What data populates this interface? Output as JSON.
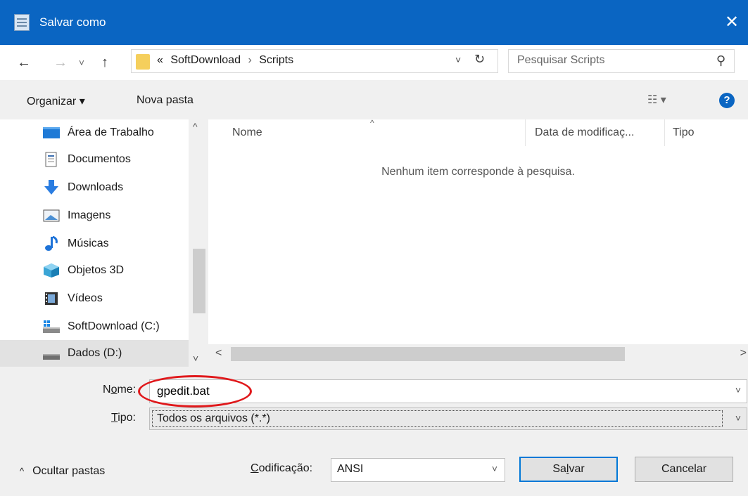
{
  "titlebar": {
    "title": "Salvar como",
    "close_glyph": "✕"
  },
  "nav": {
    "back_glyph": "←",
    "forward_glyph": "→",
    "recent_glyph": "˅",
    "up_glyph": "↑"
  },
  "address": {
    "overflow": "«",
    "crumbs": [
      "SoftDownload",
      "Scripts"
    ],
    "sep": "›",
    "dropdown_glyph": "˅",
    "refresh_glyph": "↻"
  },
  "search": {
    "placeholder": "Pesquisar Scripts",
    "icon_glyph": "⚲"
  },
  "toolbar": {
    "organize_label": "Organizar ▾",
    "new_folder_label": "Nova pasta",
    "views_glyph": "☷ ▾",
    "help_glyph": "?"
  },
  "sidebar": {
    "items": [
      {
        "label": "Área de Trabalho",
        "icon": "desktop-icon"
      },
      {
        "label": "Documentos",
        "icon": "documents-icon"
      },
      {
        "label": "Downloads",
        "icon": "downloads-icon"
      },
      {
        "label": "Imagens",
        "icon": "images-icon"
      },
      {
        "label": "Músicas",
        "icon": "music-icon"
      },
      {
        "label": "Objetos 3D",
        "icon": "3d-objects-icon"
      },
      {
        "label": "Vídeos",
        "icon": "videos-icon"
      },
      {
        "label": "SoftDownload (C:)",
        "icon": "drive-c-icon"
      },
      {
        "label": "Dados (D:)",
        "icon": "drive-d-icon",
        "selected": true
      }
    ],
    "scroll_up": "^",
    "scroll_down": "˅"
  },
  "content": {
    "columns": [
      "Nome",
      "Data de modificaç...",
      "Tipo"
    ],
    "sort_glyph": "^",
    "empty_message": "Nenhum item corresponde à pesquisa.",
    "hscroll_left": "<",
    "hscroll_right": ">"
  },
  "form": {
    "name_label_pre": "N",
    "name_label_ul": "o",
    "name_label_post": "me:",
    "name_value": "gpedit.bat",
    "type_label_ul": "T",
    "type_label_post": "ipo:",
    "type_value": "Todos os arquivos  (*.*)",
    "chevron": "˅"
  },
  "footer": {
    "hide_folders_caret": "^",
    "hide_folders_label": "Ocultar pastas",
    "encoding_label_ul": "C",
    "encoding_label_post": "odificação:",
    "encoding_value": "ANSI",
    "save_pre": "Sa",
    "save_ul": "l",
    "save_post": "var",
    "cancel_label": "Cancelar"
  },
  "colors": {
    "titlebar": "#0a65c2",
    "highlight": "#e0181b",
    "folder": "#f5cf5c",
    "accent": "#0078d7"
  }
}
